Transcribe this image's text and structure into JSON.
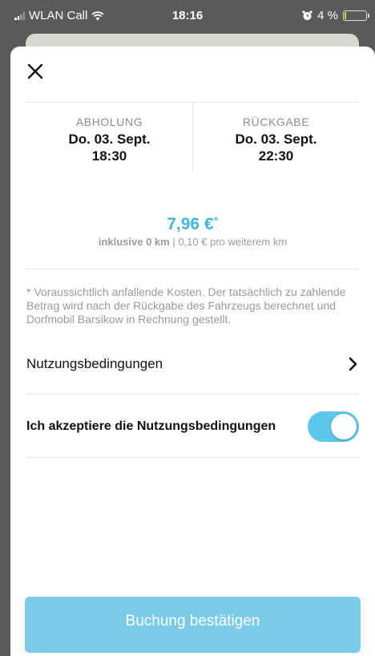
{
  "status_bar": {
    "carrier": "WLAN Call",
    "time": "18:16",
    "battery": "4 %",
    "battery_level": 0.04,
    "icons": [
      "signal-icon",
      "wifi-icon",
      "alarm-icon",
      "battery-icon"
    ]
  },
  "sheet": {
    "close_icon": "close-icon"
  },
  "pickup": {
    "title": "ABHOLUNG",
    "date": "Do. 03. Sept.",
    "time": "18:30"
  },
  "return": {
    "title": "RÜCKGABE",
    "date": "Do. 03. Sept.",
    "time": "22:30"
  },
  "price": {
    "amount": "7,96 €",
    "star": "*",
    "included": "inklusive 0 km",
    "separator": " | ",
    "per_km": "0,10 € pro weiterem km"
  },
  "note": "* Voraussichtlich anfallende Kosten. Der tatsächlich zu zahlende Betrag wird nach der Rückgabe des Fahrzeugs berechnet und Dorfmobil Barsikow in Rechnung gestellt.",
  "terms": {
    "label": "Nutzungsbedingungen",
    "icon": "chevron-right-icon"
  },
  "accept": {
    "label": "Ich akzeptiere die Nutzungsbedingungen",
    "enabled": true
  },
  "confirm_button": {
    "label": "Buchung bestätigen"
  },
  "colors": {
    "accent": "#3fb7dd",
    "toggle": "#5bc7ec",
    "button": "#79cbe7",
    "battery_low": "#e8d83a"
  }
}
